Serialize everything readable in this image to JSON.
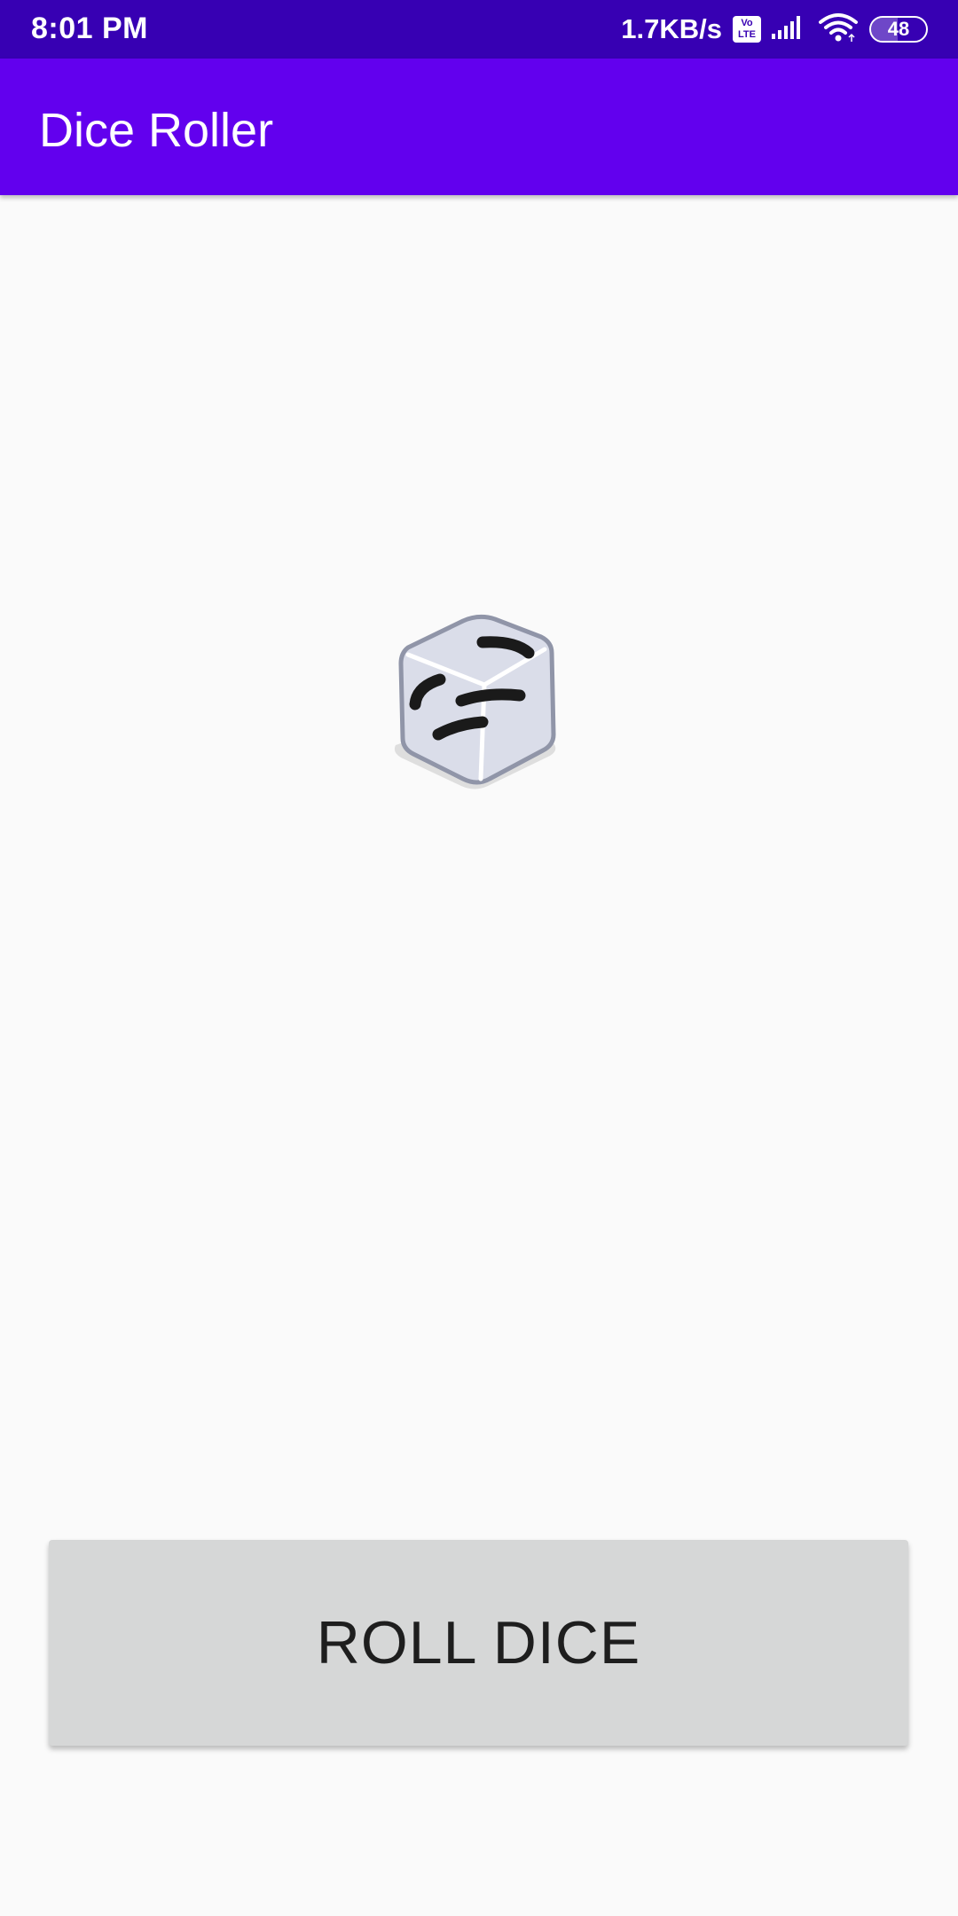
{
  "status_bar": {
    "time": "8:01 PM",
    "network_speed": "1.7KB/s",
    "volte_label_top": "Vo",
    "volte_label_bottom": "LTE",
    "signal_icon": "cellular-signal-icon",
    "wifi_icon": "wifi-icon",
    "battery_level": "48",
    "battery_fraction": 0.48
  },
  "app_bar": {
    "title": "Dice Roller",
    "background_color": "#6200ee"
  },
  "main": {
    "dice_icon": "empty-dice-icon",
    "roll_button_label": "ROLL DICE"
  }
}
